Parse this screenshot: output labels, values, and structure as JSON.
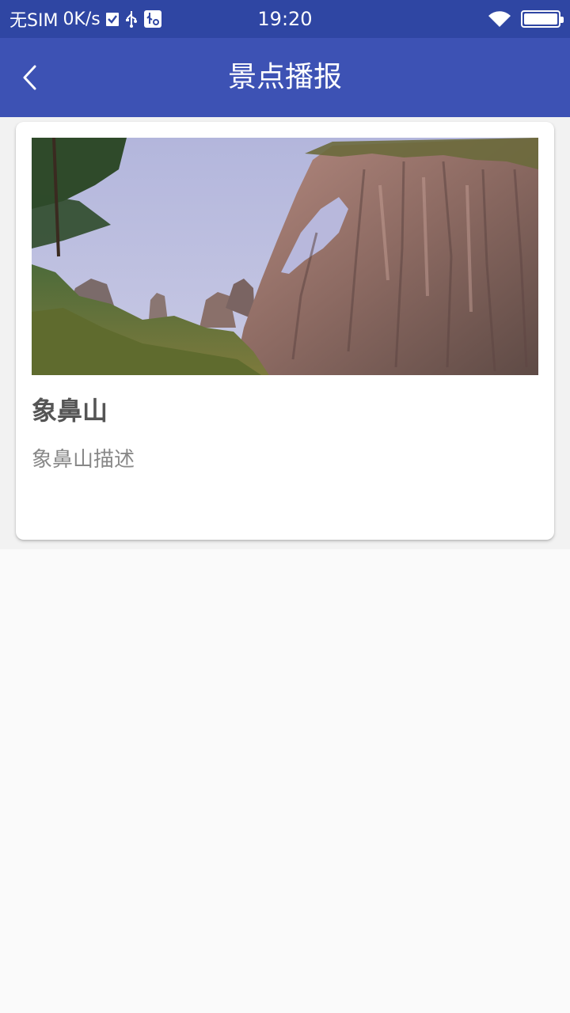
{
  "status_bar": {
    "carrier": "无SIM",
    "net_speed": "0K/s",
    "time": "19:20",
    "icons": [
      "checkbox-icon",
      "usb-icon",
      "usb-settings-icon",
      "wifi-icon",
      "battery-icon"
    ],
    "battery_level": 1.0
  },
  "app_bar": {
    "title": "景点播报",
    "back_icon": "chevron-left-icon"
  },
  "spots": [
    {
      "name": "象鼻山",
      "description": "象鼻山描述",
      "image_alt": "elephant-trunk-hill-photo"
    }
  ],
  "colors": {
    "status_bar_bg": "#2f46a3",
    "app_bar_bg": "#3d52b4",
    "title_text": "#555555",
    "desc_text": "#888888"
  }
}
